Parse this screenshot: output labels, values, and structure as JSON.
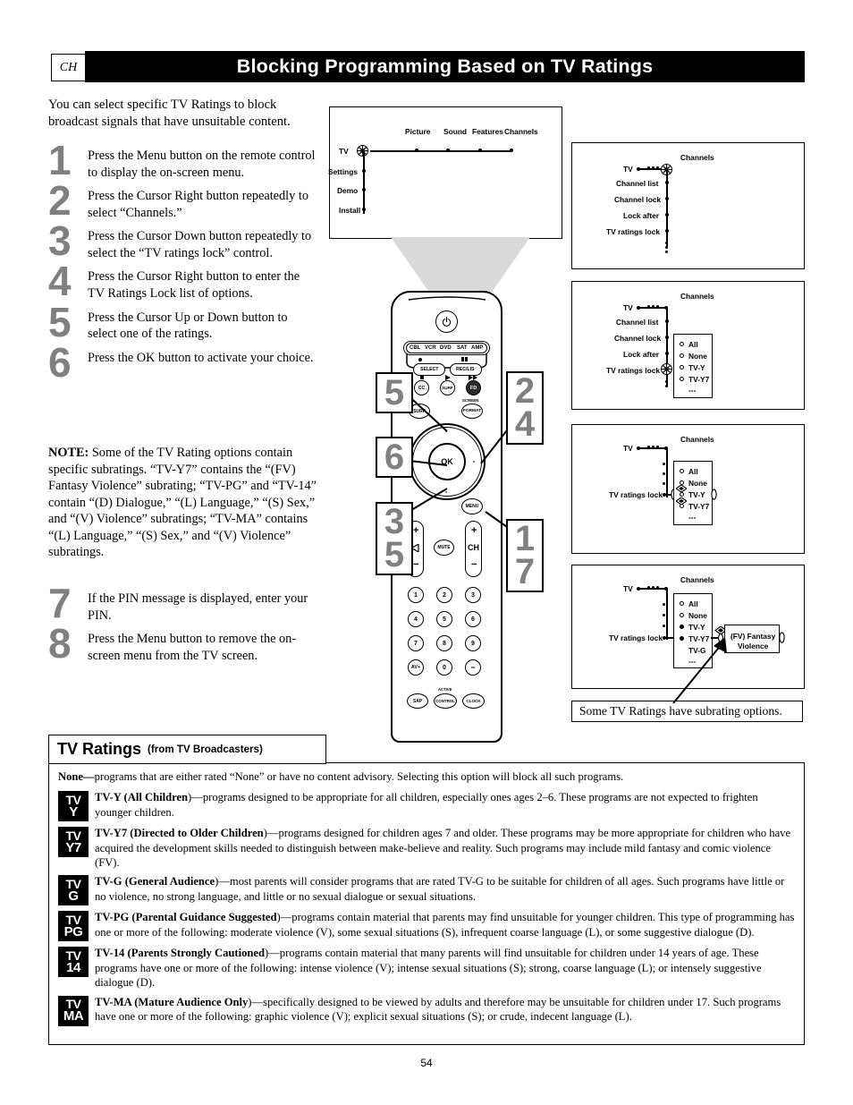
{
  "header": {
    "tab_label": "CH",
    "title": "Blocking Programming Based on TV Ratings"
  },
  "intro": "You can select specific TV Ratings to block broadcast signals that have unsuitable content.",
  "steps": [
    {
      "num": "1",
      "text": "Press the Menu button on the remote control to display the on-screen menu."
    },
    {
      "num": "2",
      "text": "Press the Cursor Right button repeatedly to select “Channels.”"
    },
    {
      "num": "3",
      "text": "Press the Cursor Down button repeatedly to select the “TV ratings lock” control."
    },
    {
      "num": "4",
      "text": "Press the Cursor Right button to enter the TV Ratings Lock list of options."
    },
    {
      "num": "5",
      "text": "Press the Cursor Up or Down button to select one of the ratings."
    },
    {
      "num": "6",
      "text": "Press the OK button to activate your choice."
    }
  ],
  "note": {
    "label": "NOTE:",
    "text": " Some of the TV Rating options contain specific subratings. “TV-Y7” contains the “(FV) Fantasy Violence” subrating; “TV-PG” and “TV-14” contain “(D) Dialogue,” “(L) Language,” “(S) Sex,” and “(V) Violence” subratings; “TV-MA” contains “(L) Language,” “(S) Sex,” and “(V) Violence” subratings."
  },
  "steps2": [
    {
      "num": "7",
      "text": "If the PIN message is displayed, enter your PIN."
    },
    {
      "num": "8",
      "text": "Press the Menu button to remove the on-screen menu from the TV screen."
    }
  ],
  "tv_menu": {
    "root": "TV",
    "top_items": [
      "Picture",
      "Sound",
      "Features",
      "Channels"
    ],
    "side_items": [
      "Settings",
      "Demo",
      "Install"
    ]
  },
  "panels": [
    {
      "id": "panel-1",
      "root": "TV",
      "heading": "Channels",
      "items": [
        "Channel list",
        "Channel lock",
        "Lock after",
        "TV ratings lock"
      ],
      "ellipsis": "⋮"
    },
    {
      "id": "panel-2",
      "root": "TV",
      "heading": "Channels",
      "items": [
        "Channel list",
        "Channel lock",
        "Lock after",
        "TV ratings lock"
      ],
      "options": [
        "All",
        "None",
        "TV-Y",
        "TV-Y7",
        "---"
      ],
      "selected_index": -1
    },
    {
      "id": "panel-3",
      "root": "TV",
      "heading": "Channels",
      "item_label": "TV ratings lock",
      "options": [
        "All",
        "None",
        "TV-Y",
        "TV-Y7",
        "---"
      ],
      "selected_index": 2
    },
    {
      "id": "panel-4",
      "root": "TV",
      "heading": "Channels",
      "item_label": "TV ratings lock",
      "options": [
        "All",
        "None",
        "TV-Y",
        "TV-Y7",
        "TV-G",
        "---"
      ],
      "filled": [
        2,
        3
      ],
      "subrating_line1": "(FV)  Fantasy",
      "subrating_line2": "Violence"
    }
  ],
  "caption": "Some TV Ratings have subrating options.",
  "remote": {
    "power_icon": "power-icon",
    "device_keys": [
      "CBL",
      "VCR",
      "DVD",
      "SAT",
      "AMP"
    ],
    "select_label": "SELECT",
    "rec_pause_label": "REC/LIS",
    "cc_label": "CC",
    "surf_label_small": "SURF",
    "fwd_label": "FD",
    "screen_label": "SCREEN",
    "format_label": "FORMAT",
    "surf_label": "SURF",
    "ok_label": "OK",
    "menu_label": "MENU",
    "mute_label": "MUTE",
    "ch_label": "CH",
    "vol_plus": "+",
    "vol_minus": "−",
    "ch_plus": "+",
    "ch_minus": "−",
    "numbers": [
      "1",
      "2",
      "3",
      "4",
      "5",
      "6",
      "7",
      "8",
      "9",
      "AV+",
      "0",
      "−"
    ],
    "sap_label": "SAP",
    "active_label": "ACTIVE",
    "control_label": "CONTROL",
    "clock_label": "CLOCK"
  },
  "callouts": [
    {
      "id": "callout-5",
      "lines": [
        "5"
      ]
    },
    {
      "id": "callout-2-4",
      "lines": [
        "2",
        "4"
      ]
    },
    {
      "id": "callout-6",
      "lines": [
        "6"
      ]
    },
    {
      "id": "callout-3-5",
      "lines": [
        "3",
        "5"
      ]
    },
    {
      "id": "callout-1-7",
      "lines": [
        "1",
        "7"
      ]
    }
  ],
  "ratings": {
    "title": "TV Ratings",
    "subtitle": "(from TV Broadcasters)",
    "none_label": "None—",
    "none_text": "programs that are either rated “None” or have no content advisory. Selecting this option will block all such programs.",
    "items": [
      {
        "icon_line1": "TV",
        "icon_line2": "Y",
        "name": "TV-Y (",
        "bold_name": "All Children",
        "tail": ")—programs designed to be appropriate for all children, especially ones ages 2–6. These programs are not expected to frighten younger children."
      },
      {
        "icon_line1": "TV",
        "icon_line2": "Y7",
        "name": "TV-Y7 (",
        "bold_name": "Directed to Older Children",
        "tail": ")—programs designed for children ages 7 and older. These programs may be more appropriate for children who have acquired the development skills needed to distinguish between make-believe and reality. Such programs may include mild fantasy and comic violence (FV)."
      },
      {
        "icon_line1": "TV",
        "icon_line2": "G",
        "name": "TV-G (",
        "bold_name": "General Audience",
        "tail": ")—most parents will consider programs that are rated TV-G to be suitable for children of all ages. Such programs have little or no violence, no strong language, and little or no sexual dialogue or sexual situations."
      },
      {
        "icon_line1": "TV",
        "icon_line2": "PG",
        "name": "TV-PG (",
        "bold_name": "Parental Guidance Suggested",
        "tail": ")—programs contain material that parents may find unsuitable for younger children. This type of programming has one or more of the following: moderate violence (V), some sexual situations (S), infrequent coarse language (L), or some suggestive dialogue (D)."
      },
      {
        "icon_line1": "TV",
        "icon_line2": "14",
        "name": "TV-14 (",
        "bold_name": "Parents Strongly Cautioned",
        "tail": ")—programs contain material that many parents will find unsuitable for children under 14 years of age. These programs have one or more of the following: intense violence (V); intense sexual situations (S); strong, coarse language (L); or intensely suggestive dialogue (D)."
      },
      {
        "icon_line1": "TV",
        "icon_line2": "MA",
        "name": "TV-MA (",
        "bold_name": "Mature Audience Only",
        "tail": ")—specifically designed to be viewed by adults and therefore may be unsuitable for children under 17. Such programs have one or more of the following: graphic violence (V); explicit sexual situations (S); or crude, indecent language (L)."
      }
    ]
  },
  "page_number": "54"
}
